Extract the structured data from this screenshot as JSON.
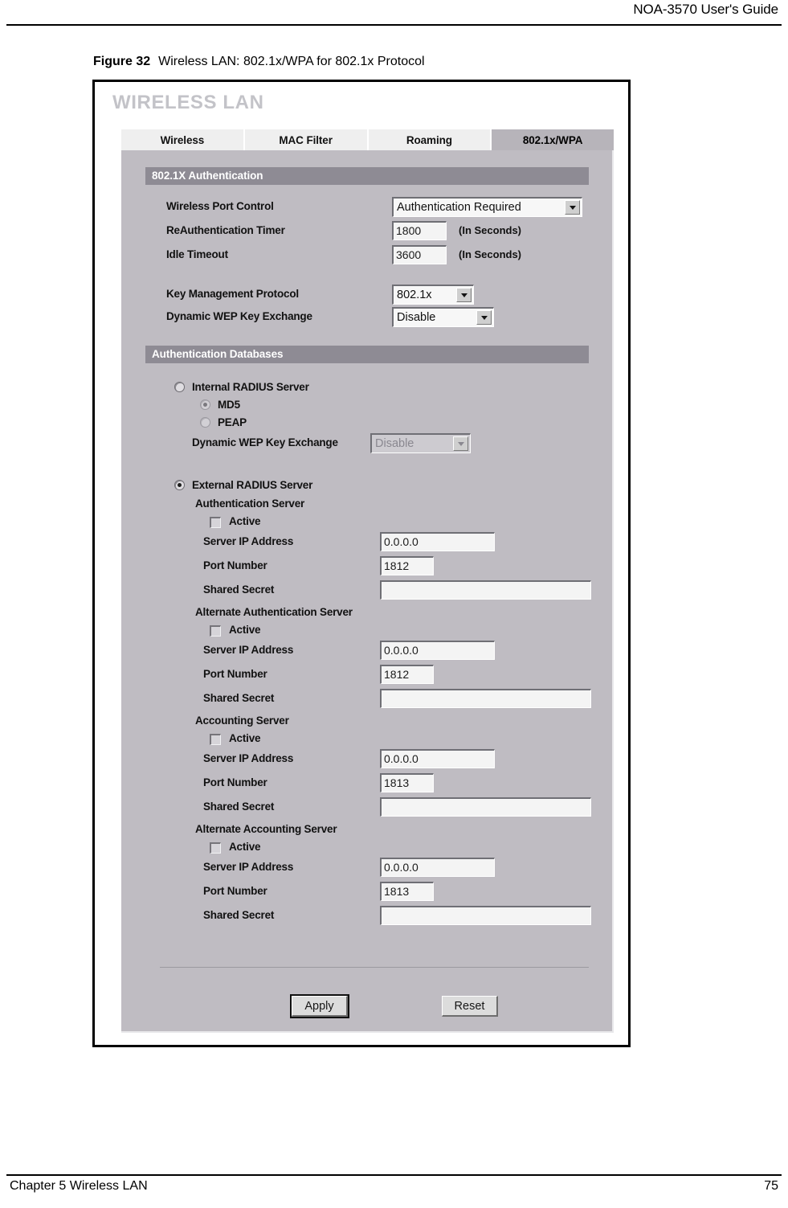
{
  "page": {
    "header_title": "NOA-3570 User's Guide",
    "footer_left": "Chapter 5 Wireless LAN",
    "footer_right": "75"
  },
  "figure": {
    "number": "Figure 32",
    "caption": "Wireless LAN: 802.1x/WPA for 802.1x Protocol"
  },
  "screenshot": {
    "app_title": "WIRELESS LAN",
    "tabs": [
      {
        "label": "Wireless",
        "active": false
      },
      {
        "label": "MAC Filter",
        "active": false
      },
      {
        "label": "Roaming",
        "active": false
      },
      {
        "label": "802.1x/WPA",
        "active": true
      }
    ],
    "auth_section": {
      "title": "802.1X Authentication",
      "wireless_port_control_label": "Wireless Port Control",
      "wireless_port_control_value": "Authentication Required",
      "reauth_timer_label": "ReAuthentication Timer",
      "reauth_timer_value": "1800",
      "reauth_timer_unit": "(In Seconds)",
      "idle_timeout_label": "Idle Timeout",
      "idle_timeout_value": "3600",
      "idle_timeout_unit": "(In Seconds)",
      "key_mgmt_label": "Key Management Protocol",
      "key_mgmt_value": "802.1x",
      "dynamic_wep_label": "Dynamic WEP Key Exchange",
      "dynamic_wep_value": "Disable"
    },
    "databases_section": {
      "title": "Authentication Databases",
      "internal": {
        "label": "Internal RADIUS Server",
        "selected": false,
        "options": [
          {
            "label": "MD5",
            "selected": true
          },
          {
            "label": "PEAP",
            "selected": false
          }
        ],
        "dynamic_wep_label": "Dynamic WEP Key Exchange",
        "dynamic_wep_value": "Disable",
        "dynamic_wep_disabled": true
      },
      "external": {
        "label": "External RADIUS Server",
        "selected": true,
        "groups": [
          {
            "title": "Authentication Server",
            "active_label": "Active",
            "active_checked": false,
            "ip_label": "Server IP Address",
            "ip_value": "0.0.0.0",
            "port_label": "Port Number",
            "port_value": "1812",
            "secret_label": "Shared Secret",
            "secret_value": ""
          },
          {
            "title": "Alternate Authentication Server",
            "active_label": "Active",
            "active_checked": false,
            "ip_label": "Server IP Address",
            "ip_value": "0.0.0.0",
            "port_label": "Port Number",
            "port_value": "1812",
            "secret_label": "Shared Secret",
            "secret_value": ""
          },
          {
            "title": "Accounting Server",
            "active_label": "Active",
            "active_checked": false,
            "ip_label": "Server IP Address",
            "ip_value": "0.0.0.0",
            "port_label": "Port Number",
            "port_value": "1813",
            "secret_label": "Shared Secret",
            "secret_value": ""
          },
          {
            "title": "Alternate Accounting Server",
            "active_label": "Active",
            "active_checked": false,
            "ip_label": "Server IP Address",
            "ip_value": "0.0.0.0",
            "port_label": "Port Number",
            "port_value": "1813",
            "secret_label": "Shared Secret",
            "secret_value": ""
          }
        ]
      }
    },
    "buttons": {
      "apply": "Apply",
      "reset": "Reset"
    },
    "colors": {
      "panel_bg": "#bfbcc2",
      "section_bar": "#8e8b94",
      "tab_inactive": "#efefef",
      "tab_active": "#b7b4ba",
      "app_title": "#c3c3c8",
      "field_bg": "#f4f4f4",
      "button_bg": "#dcdcdc"
    }
  }
}
